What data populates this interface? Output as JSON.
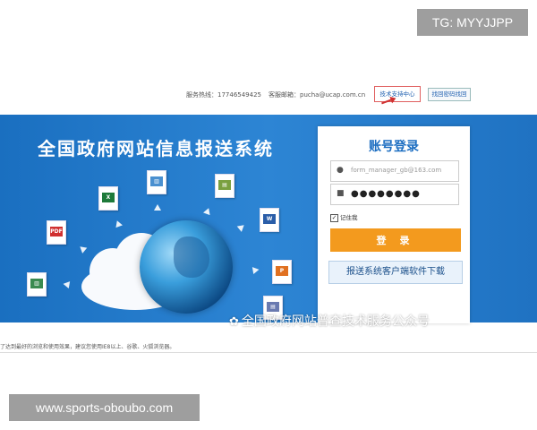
{
  "watermark_top": "TG: MYYJJPP",
  "watermark_bottom": "www.sports-oboubo.com",
  "header": {
    "hotline": "服务热线：17746549425",
    "email": "客服邮箱：pucha@ucap.com.cn",
    "tech_support": "技术支持中心",
    "find_password": "找回密码找回"
  },
  "banner": {
    "title": "全国政府网站信息报送系统",
    "doc_icons": [
      "xls",
      "chart",
      "doc",
      "pdf",
      "word",
      "chart",
      "ppt",
      "doc"
    ],
    "wechat_label": "全国政府网站普查技术服务公众号"
  },
  "login": {
    "title": "账号登录",
    "username_value": "form_manager_gb@163.com",
    "password_value": "●●●●●●●●",
    "remember_label": "记住我",
    "remember_checked": true,
    "login_button": "登 录",
    "download_button": "报送系统客户端软件下载"
  },
  "footer": {
    "note": "了达到最好的浏览和使用效果，建议您使用IE8以上、谷歌、火狐浏览器。"
  },
  "colors": {
    "banner_blue": "#1f72c2",
    "login_orange": "#f39a1e",
    "title_blue": "#1b6dc1"
  }
}
